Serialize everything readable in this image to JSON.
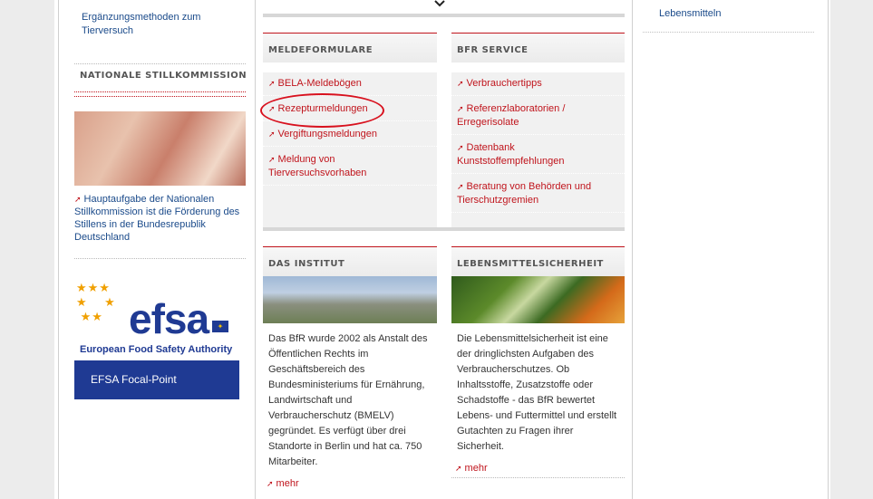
{
  "left": {
    "top_link": "Ergänzungsmethoden zum Tierversuch",
    "stillkommission": {
      "title": "NATIONALE STILLKOMMISSION",
      "text": "Hauptaufgabe der Nationalen Stillkommission ist die Förderung des Stillens in der Bundesrepublik Deutschland"
    },
    "efsa": {
      "logo_word": "efsa",
      "subtitle": "European Food Safety Authority",
      "button": "EFSA Focal-Point"
    }
  },
  "meldeformulare": {
    "title": "MELDEFORMULARE",
    "items": [
      "BELA-Meldebögen",
      "Rezepturmeldungen",
      "Vergiftungsmeldungen",
      "Meldung von Tierversuchsvorhaben"
    ]
  },
  "bfr_service": {
    "title": "BFR SERVICE",
    "items": [
      "Verbrauchertipps",
      "Referenzlaboratorien / Erregerisolate",
      "Datenbank Kunststoffempfehlungen",
      "Beratung von Behörden und Tierschutzgremien"
    ]
  },
  "institut": {
    "title": "DAS INSTITUT",
    "text": "Das BfR wurde 2002 als Anstalt des Öffentlichen Rechts im Geschäftsbereich des Bundesministeriums für Ernährung, Landwirtschaft und Verbraucherschutz (BMELV) gegründet. Es verfügt über drei Standorte in Berlin und hat ca. 750 Mitarbeiter.",
    "more": "mehr"
  },
  "lebensmittel": {
    "title": "LEBENSMITTELSICHERHEIT",
    "text": "Die Lebensmittelsicherheit ist eine der dringlichsten Aufgaben des Verbraucherschutzes. Ob Inhaltsstoffe, Zusatzstoffe oder Schadstoffe - das BfR bewertet Lebens- und Futtermittel und erstellt Gutachten zu Fragen ihrer Sicherheit.",
    "more": "mehr"
  },
  "right": {
    "link": "Lebensmitteln"
  }
}
